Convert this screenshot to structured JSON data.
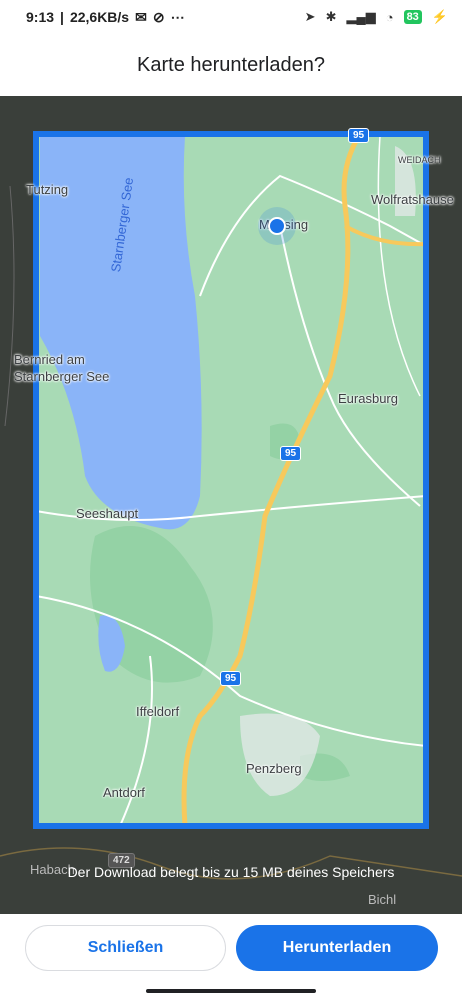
{
  "status_bar": {
    "time": "9:13",
    "speed": "22,6KB/s",
    "battery": "83",
    "icons": [
      "mail-icon",
      "sync-icon",
      "more-icon",
      "location-icon",
      "bluetooth-icon",
      "signal-icon",
      "wifi-icon",
      "battery-icon",
      "charging-icon"
    ]
  },
  "dialog": {
    "title": "Karte herunterladen?",
    "download_info": "Der Download belegt bis zu 15 MB deines Speichers"
  },
  "map": {
    "lake_label": "Starnberger See",
    "place_labels": {
      "tutzing": "Tutzing",
      "weidach": "WEIDACH",
      "wolfratshausen": "Wolfratshause",
      "munsing": "Münsing",
      "bernried_1": "Bernried am",
      "bernried_2": "Starnberger See",
      "eurasburg": "Eurasburg",
      "seeshaupt": "Seeshaupt",
      "iffeldorf": "Iffeldorf",
      "penzberg": "Penzberg",
      "antdorf": "Antdorf",
      "habach": "Habach",
      "bichl": "Bichl"
    },
    "road_shields": {
      "r95_top": "95",
      "r95_mid": "95",
      "r95_low": "95",
      "r472": "472"
    },
    "colors": {
      "selection": "#1a73e8",
      "water": "#8ab4f8",
      "land": "#a8dab5"
    }
  },
  "buttons": {
    "close_label": "Schließen",
    "download_label": "Herunterladen"
  }
}
